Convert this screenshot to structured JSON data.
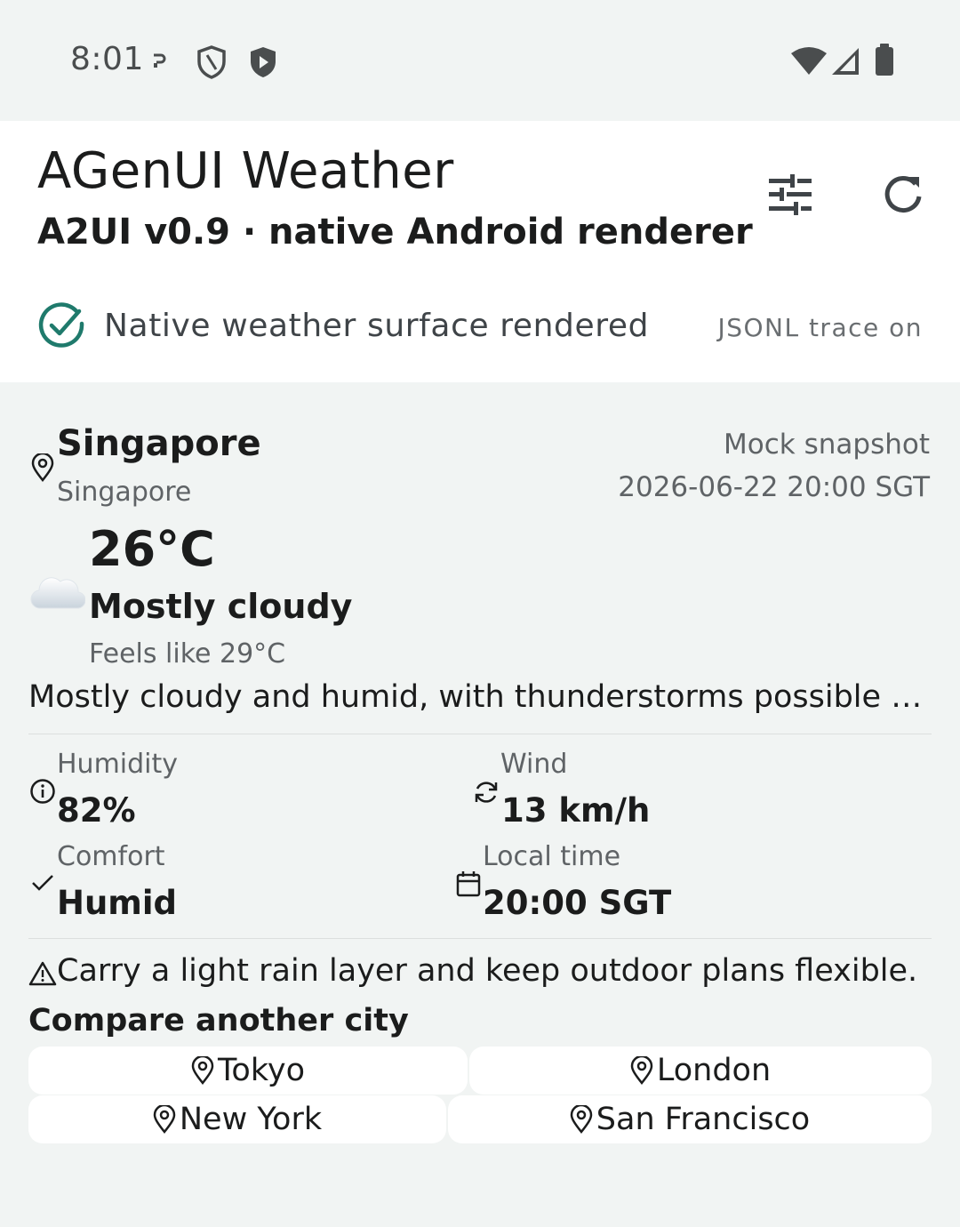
{
  "status_bar": {
    "time": "8:01",
    "icons": [
      "cast-icon",
      "shield-outline-icon",
      "shield-play-icon",
      "wifi-icon",
      "signal-icon",
      "battery-icon"
    ]
  },
  "app_bar": {
    "title": "AGenUI Weather",
    "subtitle": "A2UI v0.9 · native Android renderer",
    "actions": [
      "tune-icon",
      "refresh-icon"
    ],
    "render_status": "Native weather surface rendered",
    "trace_label": "JSONL trace on",
    "accent_color": "#1f7a6c"
  },
  "weather": {
    "city": "Singapore",
    "country": "Singapore",
    "snapshot_label": "Mock snapshot",
    "snapshot_time": "2026-06-22 20:00 SGT",
    "temperature": "26°C",
    "condition": "Mostly cloudy",
    "condition_icon": "☁️",
    "feels_like": "Feels like 29°C",
    "summary": "Mostly cloudy and humid, with thunderstorms possible during the evening.",
    "metrics": [
      {
        "label": "Humidity",
        "value": "82%",
        "icon": "info-icon"
      },
      {
        "label": "Wind",
        "value": "13 km/h",
        "icon": "refresh-cw-icon"
      },
      {
        "label": "Comfort",
        "value": "Humid",
        "icon": "check-icon"
      },
      {
        "label": "Local time",
        "value": "20:00 SGT",
        "icon": "calendar-icon"
      }
    ],
    "advice": "Carry a light rain layer and keep outdoor plans flexible."
  },
  "compare": {
    "title": "Compare another city",
    "cities": [
      "Tokyo",
      "London",
      "New York",
      "San Francisco"
    ]
  }
}
